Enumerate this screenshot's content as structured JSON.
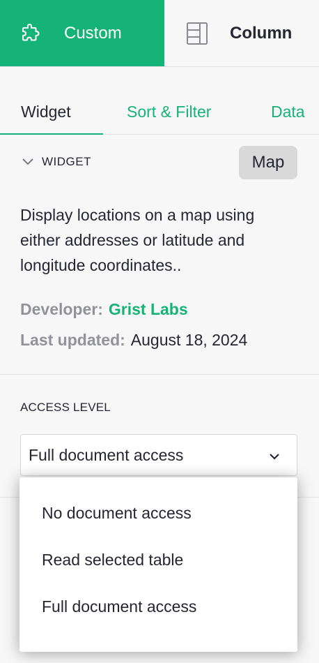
{
  "top_tabs": {
    "custom": {
      "label": "Custom",
      "icon": "puzzle-piece-icon"
    },
    "column": {
      "label": "Column",
      "icon": "column-layout-icon"
    }
  },
  "sub_tabs": [
    {
      "label": "Widget",
      "active": true
    },
    {
      "label": "Sort & Filter",
      "active": false
    },
    {
      "label": "Data",
      "active": false
    }
  ],
  "widget_section": {
    "title": "WIDGET",
    "badge": "Map",
    "description": "Display locations on a map using either addresses or latitude and longitude coordinates..",
    "developer_label": "Developer:",
    "developer_value": "Grist Labs",
    "updated_label": "Last updated:",
    "updated_value": "August 18, 2024"
  },
  "access": {
    "title": "ACCESS LEVEL",
    "selected": "Full document access",
    "options": [
      "No document access",
      "Read selected table",
      "Full document access"
    ]
  },
  "colors": {
    "accent": "#16b378",
    "text": "#262633",
    "muted": "#929299",
    "background": "#f7f7f7",
    "badge_bg": "#d9d9d9"
  }
}
